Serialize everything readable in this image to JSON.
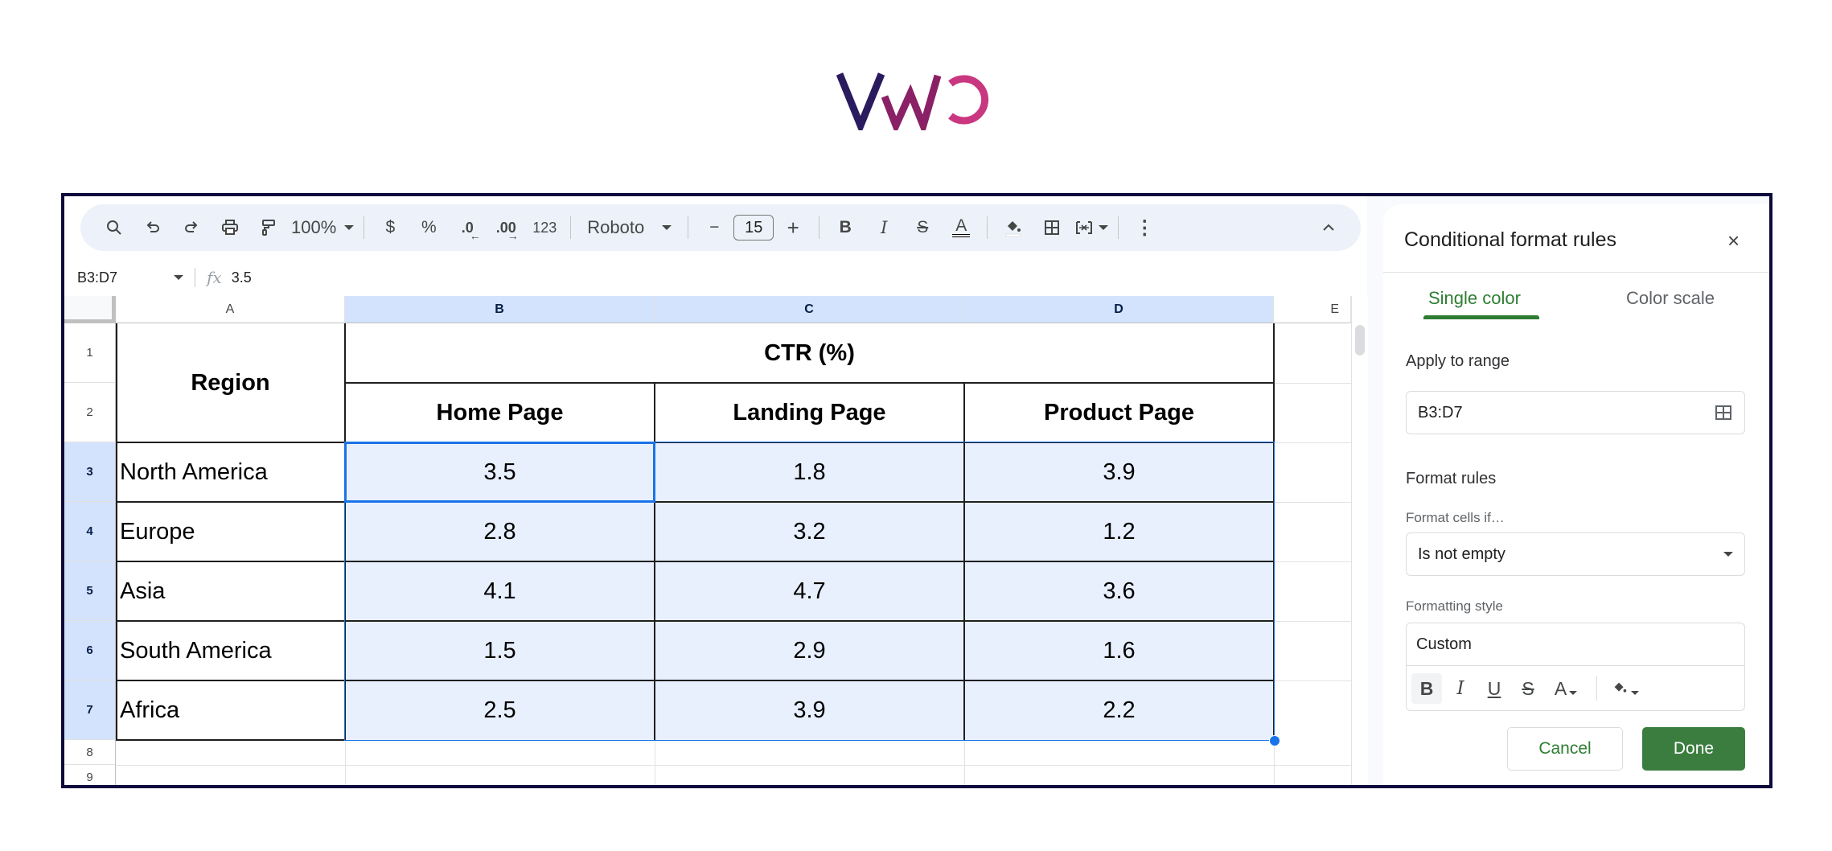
{
  "logo": {
    "text": "VWO",
    "colors": [
      "#2a1a5e",
      "#8a2166",
      "#c8377f"
    ]
  },
  "toolbar": {
    "zoom": "100%",
    "currency": "$",
    "percent": "%",
    "decrease_decimals": ".0",
    "increase_decimals": ".00",
    "more_formats": "123",
    "font": "Roboto",
    "font_size": "15",
    "minus": "−",
    "plus": "+"
  },
  "formula_bar": {
    "name_box": "B3:D7",
    "fx": "fx",
    "value": "3.5"
  },
  "sheet": {
    "columns": [
      "A",
      "B",
      "C",
      "D",
      "E"
    ],
    "rows": [
      "1",
      "2",
      "3",
      "4",
      "5",
      "6",
      "7",
      "8",
      "9"
    ],
    "header": {
      "region": "Region",
      "group": "CTR (%)",
      "subheaders": [
        "Home Page",
        "Landing Page",
        "Product Page"
      ]
    },
    "data": [
      {
        "region": "North America",
        "values": [
          "3.5",
          "1.8",
          "3.9"
        ]
      },
      {
        "region": "Europe",
        "values": [
          "2.8",
          "3.2",
          "1.2"
        ]
      },
      {
        "region": "Asia",
        "values": [
          "4.1",
          "4.7",
          "3.6"
        ]
      },
      {
        "region": "South America",
        "values": [
          "1.5",
          "2.9",
          "1.6"
        ]
      },
      {
        "region": "Africa",
        "values": [
          "2.5",
          "3.9",
          "2.2"
        ]
      }
    ],
    "selection": "B3:D7",
    "selection_color": "#e8f0fe",
    "accent": "#1a73e8"
  },
  "panel": {
    "title": "Conditional format rules",
    "close": "×",
    "tabs": [
      {
        "label": "Single color",
        "active": true
      },
      {
        "label": "Color scale",
        "active": false
      }
    ],
    "apply_to_range_label": "Apply to range",
    "range_value": "B3:D7",
    "format_rules_label": "Format rules",
    "format_cells_if_label": "Format cells if…",
    "condition": "Is not empty",
    "formatting_style_label": "Formatting style",
    "style_preview": "Custom",
    "style_tools": {
      "bold": "B",
      "italic": "I",
      "underline": "U",
      "strike": "S",
      "text_color": "A"
    },
    "cancel": "Cancel",
    "done": "Done",
    "accent": "#2e7d32"
  }
}
